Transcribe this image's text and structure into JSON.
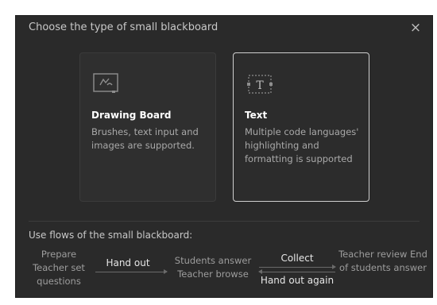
{
  "dialog": {
    "title": "Choose the type of small blackboard",
    "close_label": "×"
  },
  "cards": [
    {
      "title": "Drawing Board",
      "description": "Brushes, text input and images are supported.",
      "icon": "drawing-board-icon",
      "selected": false
    },
    {
      "title": "Text",
      "description": "Multiple code languages' highlighting and formatting is supported",
      "icon": "text-icon",
      "selected": true
    }
  ],
  "flows": {
    "label": "Use flows of the small blackboard:",
    "steps": [
      "Prepare Teacher set questions",
      "Students answer Teacher browse",
      "Teacher review End of students answer"
    ],
    "actions": {
      "hand_out": "Hand out",
      "collect": "Collect",
      "hand_out_again": "Hand out again"
    }
  }
}
